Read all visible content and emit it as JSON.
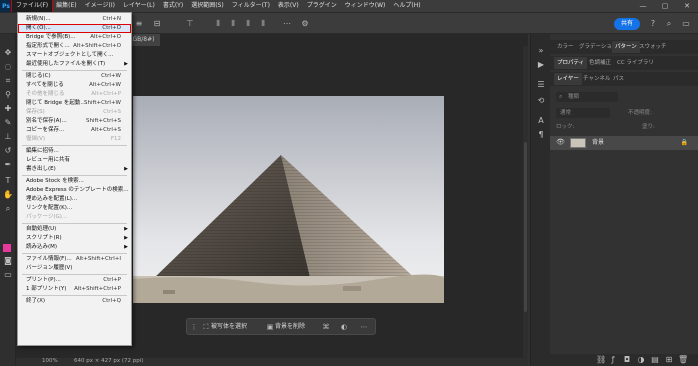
{
  "app": {
    "logo": "Ps"
  },
  "menubar": {
    "items": [
      "ファイル(F)",
      "編集(E)",
      "イメージ(I)",
      "レイヤー(L)",
      "書式(Y)",
      "選択範囲(S)",
      "フィルター(T)",
      "表示(V)",
      "プラグイン",
      "ウィンドウ(W)",
      "ヘルプ(H)"
    ]
  },
  "window_controls": {
    "minimize": "—",
    "maximize": "▢",
    "close": "✕"
  },
  "options_bar": {
    "share_label": "共有"
  },
  "document": {
    "tab_label": "(RGB/8#)"
  },
  "context_bar": {
    "select_subject": "被写体を選択",
    "remove_bg": "背景を削除"
  },
  "status_bar": {
    "zoom": "100%",
    "dims": "640 px × 427 px (72 ppi)"
  },
  "panels": {
    "top_tabs": [
      "カラー",
      "グラデーション",
      "パターン",
      "スウォッチ"
    ],
    "mid_tabs": [
      "プロパティ",
      "色調補正",
      "CC ライブラリ"
    ],
    "layer_tabs": [
      "レイヤー",
      "チャンネル",
      "パス"
    ],
    "search_placeholder": "種類",
    "blend_mode": "通常",
    "opacity_label": "不透明度:",
    "lock_label": "ロック:",
    "fill_label": "塗り:",
    "layer_name": "背景"
  },
  "file_menu": {
    "items": [
      {
        "label": "新規(N)...",
        "shortcut": "Ctrl+N"
      },
      {
        "label": "開く(O)...",
        "shortcut": "Ctrl+O",
        "highlight": true
      },
      {
        "label": "Bridge で参照(B)...",
        "shortcut": "Alt+Ctrl+O"
      },
      {
        "label": "指定形式で開く...",
        "shortcut": "Alt+Shift+Ctrl+O"
      },
      {
        "label": "スマートオブジェクトとして開く..."
      },
      {
        "label": "最近使用したファイルを開く(T)",
        "submenu": true
      },
      {
        "sep": true
      },
      {
        "label": "閉じる(C)",
        "shortcut": "Ctrl+W"
      },
      {
        "label": "すべてを閉じる",
        "shortcut": "Alt+Ctrl+W"
      },
      {
        "label": "その他を閉じる",
        "shortcut": "Alt+Ctrl+P",
        "disabled": true
      },
      {
        "label": "閉じて Bridge を起動...",
        "shortcut": "Shift+Ctrl+W"
      },
      {
        "label": "保存(S)",
        "shortcut": "Ctrl+S",
        "disabled": true
      },
      {
        "label": "別名で保存(A)...",
        "shortcut": "Shift+Ctrl+S"
      },
      {
        "label": "コピーを保存...",
        "shortcut": "Alt+Ctrl+S"
      },
      {
        "label": "復帰(V)",
        "shortcut": "F12",
        "disabled": true
      },
      {
        "sep": true
      },
      {
        "label": "編集に招待..."
      },
      {
        "label": "レビュー用に共有"
      },
      {
        "label": "書き出し(E)",
        "submenu": true
      },
      {
        "sep": true
      },
      {
        "label": "Adobe Stock を検索..."
      },
      {
        "label": "Adobe Express のテンプレートの検索..."
      },
      {
        "label": "埋め込みを配置(L)..."
      },
      {
        "label": "リンクを配置(K)..."
      },
      {
        "label": "パッケージ(G)...",
        "disabled": true
      },
      {
        "sep": true
      },
      {
        "label": "自動処理(U)",
        "submenu": true
      },
      {
        "label": "スクリプト(R)",
        "submenu": true
      },
      {
        "label": "読み込み(M)",
        "submenu": true
      },
      {
        "sep": true
      },
      {
        "label": "ファイル情報(F)...",
        "shortcut": "Alt+Shift+Ctrl+I"
      },
      {
        "label": "バージョン履歴(V)"
      },
      {
        "sep": true
      },
      {
        "label": "プリント(P)...",
        "shortcut": "Ctrl+P"
      },
      {
        "label": "1 部プリント(Y)",
        "shortcut": "Alt+Shift+Ctrl+P"
      },
      {
        "sep": true
      },
      {
        "label": "終了(X)",
        "shortcut": "Ctrl+Q"
      }
    ]
  }
}
